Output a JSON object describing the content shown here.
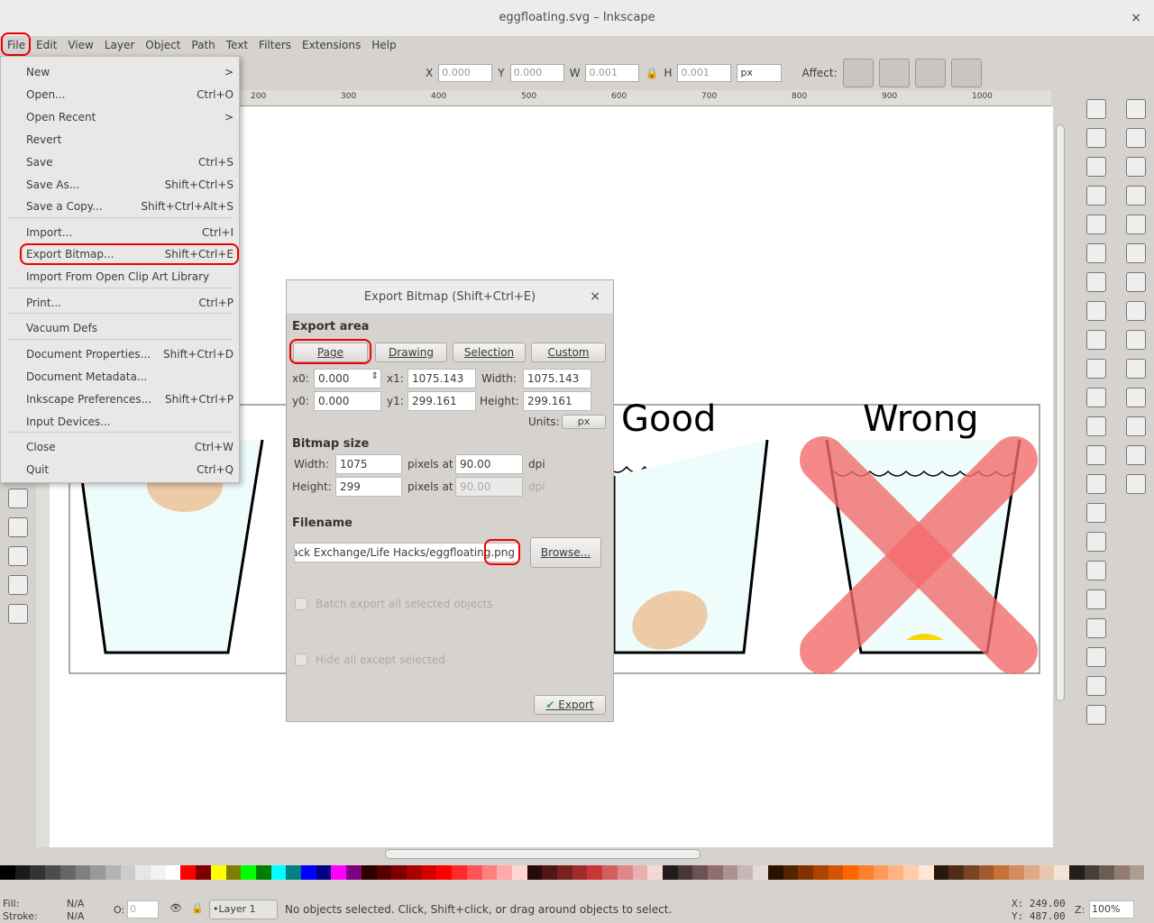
{
  "window": {
    "title": "eggfloating.svg – Inkscape",
    "close": "×"
  },
  "menubar": [
    "File",
    "Edit",
    "View",
    "Layer",
    "Object",
    "Path",
    "Text",
    "Filters",
    "Extensions",
    "Help"
  ],
  "toolbar": {
    "x_label": "X",
    "x": "0.000",
    "y_label": "Y",
    "y": "0.000",
    "w_label": "W",
    "w": "0.001",
    "h_label": "H",
    "h": "0.001",
    "units": "px",
    "affect": "Affect:"
  },
  "ruler": [
    "200",
    "300",
    "400",
    "500",
    "600",
    "700",
    "800",
    "900",
    "1000"
  ],
  "file_menu": [
    {
      "label": "New",
      "shortcut": ">"
    },
    {
      "label": "Open...",
      "shortcut": "Ctrl+O"
    },
    {
      "label": "Open Recent",
      "shortcut": ">"
    },
    {
      "label": "Revert",
      "shortcut": ""
    },
    {
      "label": "Save",
      "shortcut": "Ctrl+S"
    },
    {
      "label": "Save As...",
      "shortcut": "Shift+Ctrl+S"
    },
    {
      "label": "Save a Copy...",
      "shortcut": "Shift+Ctrl+Alt+S"
    },
    {
      "label": "Import...",
      "shortcut": "Ctrl+I"
    },
    {
      "label": "Export Bitmap...",
      "shortcut": "Shift+Ctrl+E"
    },
    {
      "label": "Import From Open Clip Art Library",
      "shortcut": ""
    },
    {
      "label": "Print...",
      "shortcut": "Ctrl+P"
    },
    {
      "label": "Vacuum Defs",
      "shortcut": ""
    },
    {
      "label": "Document Properties...",
      "shortcut": "Shift+Ctrl+D"
    },
    {
      "label": "Document Metadata...",
      "shortcut": ""
    },
    {
      "label": "Inkscape Preferences...",
      "shortcut": "Shift+Ctrl+P"
    },
    {
      "label": "Input Devices...",
      "shortcut": ""
    },
    {
      "label": "Close",
      "shortcut": "Ctrl+W"
    },
    {
      "label": "Quit",
      "shortcut": "Ctrl+Q"
    }
  ],
  "drawing": {
    "good": "Good",
    "wrong": "Wrong"
  },
  "dialog": {
    "title": "Export Bitmap (Shift+Ctrl+E)",
    "close": "×",
    "export_area": "Export area",
    "area_buttons": [
      "Page",
      "Drawing",
      "Selection",
      "Custom"
    ],
    "x0_label": "x0:",
    "x0": "0.000",
    "x1_label": "x1:",
    "x1": "1075.143",
    "width_label": "Width:",
    "width": "1075.143",
    "y0_label": "y0:",
    "y0": "0.000",
    "y1_label": "y1:",
    "y1": "299.161",
    "height_label": "Height:",
    "height": "299.161",
    "units_label": "Units:",
    "units": "px",
    "bitmap_size": "Bitmap size",
    "bw_label": "Width:",
    "bw": "1075",
    "pixels_at": "pixels at",
    "dpi_x": "90.00",
    "dpi": "dpi",
    "bh_label": "Height:",
    "bh": "299",
    "dpi_y": "90.00",
    "filename_label": "Filename",
    "filename": "Stack Exchange/Life Hacks/eggfloating.png",
    "browse": "Browse...",
    "batch": "Batch export all selected objects",
    "hide": "Hide all except selected",
    "export": "Export"
  },
  "status": {
    "fill_label": "Fill:",
    "fill": "N/A",
    "stroke_label": "Stroke:",
    "stroke": "N/A",
    "opacity_label": "O:",
    "opacity": "0",
    "layer": "•Layer 1",
    "message": "No objects selected. Click, Shift+click, or drag around objects to select.",
    "x": "X:  249.00",
    "y": "Y:  487.00",
    "zoom_label": "Z:",
    "zoom": "100%"
  },
  "palette": [
    "#000000",
    "#1a1a1a",
    "#333333",
    "#4d4d4d",
    "#666666",
    "#808080",
    "#999999",
    "#b3b3b3",
    "#cccccc",
    "#e6e6e6",
    "#f2f2f2",
    "#ffffff",
    "#ff0000",
    "#800000",
    "#ffff00",
    "#808000",
    "#00ff00",
    "#008000",
    "#00ffff",
    "#008080",
    "#0000ff",
    "#000080",
    "#ff00ff",
    "#800080",
    "#2b0000",
    "#550000",
    "#800000",
    "#aa0000",
    "#d40000",
    "#ff0000",
    "#ff2a2a",
    "#ff5555",
    "#ff8080",
    "#ffaaaa",
    "#ffd5d5",
    "#280b0b",
    "#501616",
    "#782121",
    "#a02c2c",
    "#c83737",
    "#d35f5f",
    "#de8787",
    "#e9afaf",
    "#f4d7d7",
    "#241c1c",
    "#483737",
    "#6c5353",
    "#916f6f",
    "#ac9393",
    "#c8b7b7",
    "#e3dbdb",
    "#2b1100",
    "#552200",
    "#803300",
    "#aa4400",
    "#d45500",
    "#ff6600",
    "#ff7f2a",
    "#ff9955",
    "#ffb380",
    "#ffccaa",
    "#ffe6d5",
    "#28170b",
    "#502d16",
    "#784421",
    "#a05a2c",
    "#c87137",
    "#d38d5f",
    "#deaa87",
    "#e9c6af",
    "#f4e3d7",
    "#241f1c",
    "#483e37",
    "#6c5d53",
    "#917c6f",
    "#ac9d93"
  ]
}
